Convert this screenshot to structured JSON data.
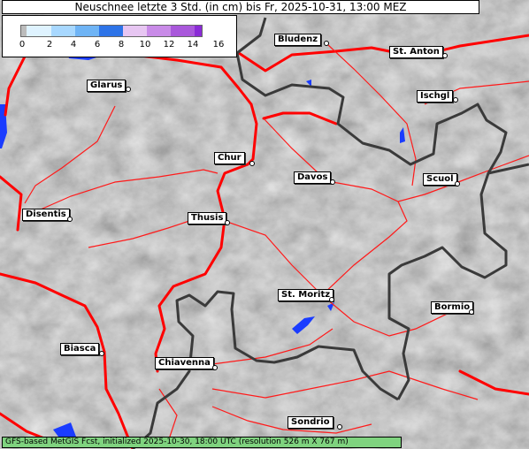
{
  "title": "Neuschnee letzte 3 Std. (in cm) bis Fr, 2025-10-31, 13:00 MEZ",
  "legend": {
    "ticks": [
      "0",
      "2",
      "4",
      "6",
      "8",
      "10",
      "12",
      "14",
      "16"
    ],
    "colors": [
      "#c8c8c8",
      "#dff3ff",
      "#a8d8ff",
      "#6fb4f5",
      "#2e74e8",
      "#e7c6f2",
      "#c98be8",
      "#a958db",
      "#8a2bd6"
    ]
  },
  "places": [
    {
      "id": "bludenz",
      "label": "Bludenz"
    },
    {
      "id": "st-anton",
      "label": "St. Anton"
    },
    {
      "id": "glarus",
      "label": "Glarus"
    },
    {
      "id": "ischgl",
      "label": "Ischgl"
    },
    {
      "id": "chur",
      "label": "Chur"
    },
    {
      "id": "davos",
      "label": "Davos"
    },
    {
      "id": "scuol",
      "label": "Scuol"
    },
    {
      "id": "disentis",
      "label": "Disentis"
    },
    {
      "id": "thusis",
      "label": "Thusis"
    },
    {
      "id": "st-moritz",
      "label": "St. Moritz"
    },
    {
      "id": "bormio",
      "label": "Bormio"
    },
    {
      "id": "biasca",
      "label": "Biasca"
    },
    {
      "id": "chiavenna",
      "label": "Chiavenna"
    },
    {
      "id": "sondrio",
      "label": "Sondrio"
    }
  ],
  "footer": "GFS-based MetGIS Fcst, initialized 2025-10-30, 18:00 UTC  (resolution 526 m X 767 m)",
  "colors": {
    "roads": "#ff0000",
    "rivers": "#ff3030",
    "borders": "#3a3a3a",
    "water": "#1a3cff",
    "footer_bg": "#7fd37f"
  }
}
